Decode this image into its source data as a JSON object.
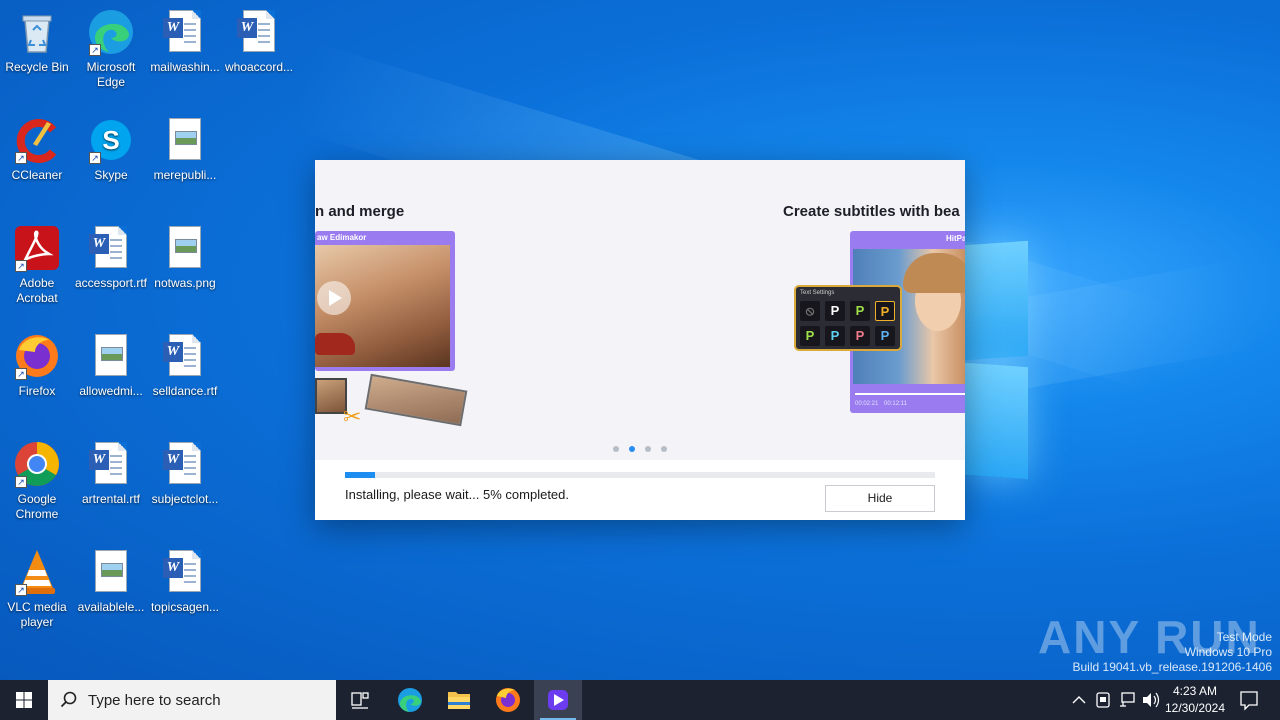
{
  "desktop_icons": [
    {
      "label": "Recycle Bin",
      "icon": "recycle-bin-icon"
    },
    {
      "label": "Microsoft Edge",
      "icon": "edge-icon"
    },
    {
      "label": "mailwashin...",
      "icon": "word-doc-icon"
    },
    {
      "label": "whoaccord...",
      "icon": "word-doc-icon"
    },
    {
      "label": "CCleaner",
      "icon": "ccleaner-icon"
    },
    {
      "label": "Skype",
      "icon": "skype-icon"
    },
    {
      "label": "merepubli...",
      "icon": "image-file-icon"
    },
    {
      "label": "Adobe Acrobat",
      "icon": "acrobat-icon"
    },
    {
      "label": "accessport.rtf",
      "icon": "word-doc-icon"
    },
    {
      "label": "notwas.png",
      "icon": "image-file-icon"
    },
    {
      "label": "Firefox",
      "icon": "firefox-icon"
    },
    {
      "label": "allowedmi...",
      "icon": "image-file-icon"
    },
    {
      "label": "selldance.rtf",
      "icon": "word-doc-icon"
    },
    {
      "label": "Google Chrome",
      "icon": "chrome-icon"
    },
    {
      "label": "artrental.rtf",
      "icon": "word-doc-icon"
    },
    {
      "label": "subjectclot...",
      "icon": "word-doc-icon"
    },
    {
      "label": "VLC media player",
      "icon": "vlc-icon"
    },
    {
      "label": "availablele...",
      "icon": "image-file-icon"
    },
    {
      "label": "topicsagen...",
      "icon": "word-doc-icon"
    }
  ],
  "installer": {
    "slide_left_title": "n and merge",
    "slide_left_brand": "aw Edimakor",
    "slide_right_title": "Create subtitles with bea",
    "slide_right_brand": "HitPa",
    "text_settings_label": "Text Settings",
    "text_style_glyph": "P",
    "player_time": "00:02:21",
    "player_total": "00:12:11",
    "dots": 4,
    "active_dot": 1,
    "progress_percent": 5,
    "status_text": "Installing, please wait... 5% completed.",
    "hide_label": "Hide",
    "accent": "#1e8df2"
  },
  "watermark": {
    "brand": "ANY RUN",
    "line1": "Test Mode",
    "line2": "Windows 10 Pro",
    "line3": "Build 19041.vb_release.191206-1406"
  },
  "taskbar": {
    "search_placeholder": "Type here to search",
    "apps": [
      "task-view-icon",
      "edge-icon",
      "file-explorer-icon",
      "firefox-icon",
      "edimakor-icon"
    ],
    "clock_time": "4:23 AM",
    "clock_date": "12/30/2024"
  }
}
